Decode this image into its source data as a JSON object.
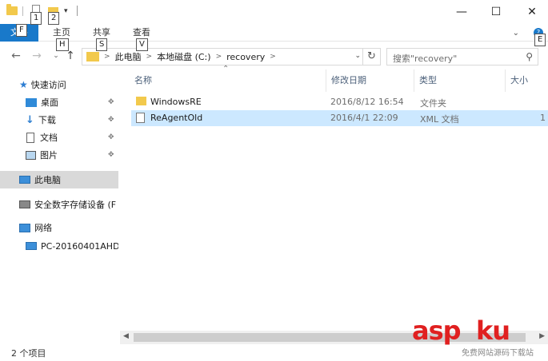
{
  "keytips": {
    "k1": "1",
    "k2": "2",
    "file": "F",
    "home": "H",
    "share": "S",
    "view": "V",
    "help_tip": "E"
  },
  "window": {
    "minimize": "—",
    "maximize": "☐",
    "close": "✕"
  },
  "ribbon": {
    "file_label": "文件",
    "home_label": "主页",
    "share_label": "共享",
    "view_label": "查看",
    "help_glyph": "?"
  },
  "address": {
    "crumbs": [
      "此电脑",
      "本地磁盘 (C:)",
      "recovery"
    ],
    "separator": ">"
  },
  "search": {
    "placeholder": "搜索\"recovery\""
  },
  "sidebar": {
    "quick_access": "快速访问",
    "desktop": "桌面",
    "downloads": "下载",
    "documents": "文档",
    "pictures": "图片",
    "this_pc": "此电脑",
    "sd_device": "安全数字存储设备 (F",
    "network": "网络",
    "pc_name": "PC-20160401AHD"
  },
  "columns": {
    "name": "名称",
    "modified": "修改日期",
    "type": "类型",
    "size": "大小"
  },
  "files": [
    {
      "name": "WindowsRE",
      "modified": "2016/8/12 16:54",
      "type": "文件夹",
      "size": ""
    },
    {
      "name": "ReAgentOld",
      "modified": "2016/4/1 22:09",
      "type": "XML 文档",
      "size": "1"
    }
  ],
  "status": {
    "item_count": "2 个项目"
  },
  "watermark": {
    "brand": "asp",
    "suffix": "ku",
    "sub": "免费网站源码下载站"
  },
  "colors": {
    "accent": "#1979ca",
    "selected_row": "#cce8ff",
    "folder": "#f2c94c",
    "watermark": "#e02020"
  }
}
